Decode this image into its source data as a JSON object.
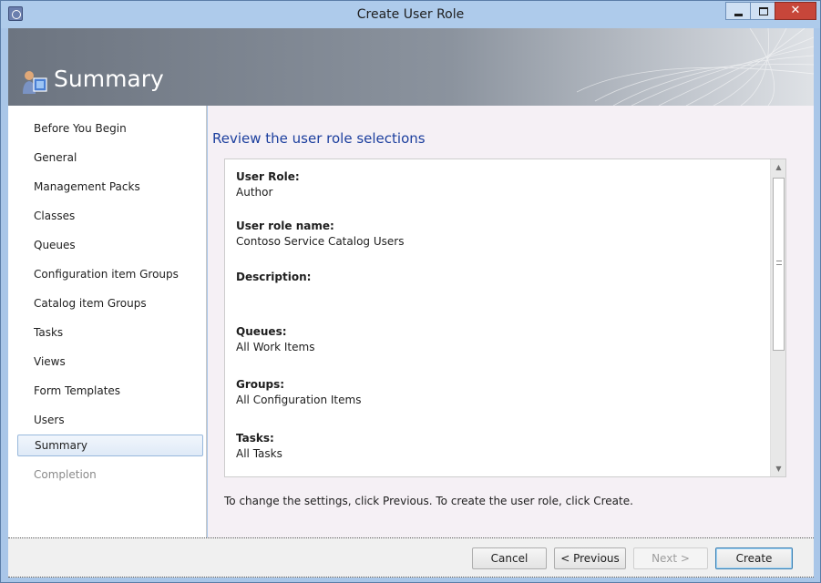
{
  "window": {
    "title": "Create User Role"
  },
  "header": {
    "title": "Summary"
  },
  "nav": {
    "items": [
      {
        "label": "Before You Begin",
        "state": "normal"
      },
      {
        "label": "General",
        "state": "normal"
      },
      {
        "label": "Management Packs",
        "state": "normal"
      },
      {
        "label": "Classes",
        "state": "normal"
      },
      {
        "label": "Queues",
        "state": "normal"
      },
      {
        "label": "Configuration item Groups",
        "state": "normal"
      },
      {
        "label": "Catalog item Groups",
        "state": "normal"
      },
      {
        "label": "Tasks",
        "state": "normal"
      },
      {
        "label": "Views",
        "state": "normal"
      },
      {
        "label": "Form Templates",
        "state": "normal"
      },
      {
        "label": "Users",
        "state": "normal"
      },
      {
        "label": "Summary",
        "state": "selected"
      },
      {
        "label": "Completion",
        "state": "disabled"
      }
    ]
  },
  "main": {
    "heading": "Review the user role selections",
    "fields": [
      {
        "label": "User Role:",
        "value": "Author"
      },
      {
        "label": "User role name:",
        "value": "Contoso Service Catalog Users"
      },
      {
        "label": "Description:",
        "value": ""
      },
      {
        "label": "Queues:",
        "value": "All Work Items"
      },
      {
        "label": "Groups:",
        "value": "All Configuration Items"
      },
      {
        "label": "Tasks:",
        "value": "All Tasks"
      }
    ],
    "hint": "To change the settings, click Previous. To create the user role, click Create."
  },
  "footer": {
    "cancel_label": "Cancel",
    "previous_label": "< Previous",
    "next_label": "Next >",
    "create_label": "Create"
  },
  "colors": {
    "heading": "#1c3f9e",
    "selection": "#dfeaf7",
    "title_bar": "#aecbeb",
    "close_button": "#c7463a"
  }
}
